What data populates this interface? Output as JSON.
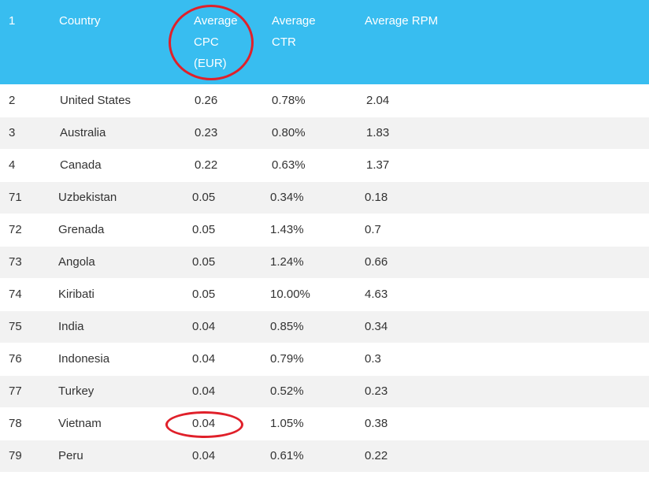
{
  "chart_data": {
    "type": "table",
    "headers": [
      "1",
      "Country",
      "Average CPC (EUR)",
      "Average CTR",
      "Average RPM"
    ],
    "header_lines": [
      [
        "1"
      ],
      [
        "Country"
      ],
      [
        "Average",
        "CPC",
        "(EUR)"
      ],
      [
        "Average",
        "CTR"
      ],
      [
        "Average RPM"
      ]
    ],
    "rows": [
      [
        "2",
        "United States",
        "0.26",
        "0.78%",
        "2.04"
      ],
      [
        "3",
        "Australia",
        "0.23",
        "0.80%",
        "1.83"
      ],
      [
        "4",
        "Canada",
        "0.22",
        "0.63%",
        "1.37"
      ],
      [
        "71",
        "Uzbekistan",
        "0.05",
        "0.34%",
        "0.18"
      ],
      [
        "72",
        "Grenada",
        "0.05",
        "1.43%",
        "0.7"
      ],
      [
        "73",
        "Angola",
        "0.05",
        "1.24%",
        "0.66"
      ],
      [
        "74",
        "Kiribati",
        "0.05",
        "10.00%",
        "4.63"
      ],
      [
        "75",
        "India",
        "0.04",
        "0.85%",
        "0.34"
      ],
      [
        "76",
        "Indonesia",
        "0.04",
        "0.79%",
        "0.3"
      ],
      [
        "77",
        "Turkey",
        "0.04",
        "0.52%",
        "0.23"
      ],
      [
        "78",
        "Vietnam",
        "0.04",
        "1.05%",
        "0.38"
      ],
      [
        "79",
        "Peru",
        "0.04",
        "0.61%",
        "0.22"
      ]
    ],
    "highlights": [
      "header: Average CPC (EUR)",
      "row 78 Vietnam: 0.04"
    ]
  },
  "colors": {
    "header_bg": "#38bdf0",
    "header_text": "#ffffff",
    "row_alt_bg": "#f2f2f2",
    "annotation": "#e0202a"
  }
}
